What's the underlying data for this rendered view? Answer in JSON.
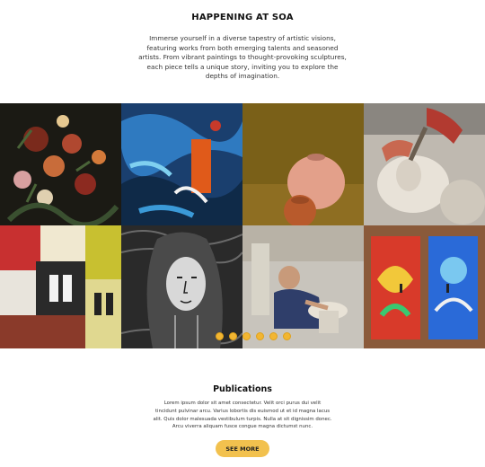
{
  "hero": {
    "title": "HAPPENING AT SOA",
    "description": "Immerse yourself in a diverse tapestry of artistic visions, featuring works from both emerging talents and seasoned artists. From vibrant paintings to thought-provoking sculptures, each piece tells a unique story, inviting you to explore the depths of imagination."
  },
  "gallery": {
    "tiles": [
      {
        "name": "floral-still-life-image"
      },
      {
        "name": "abstract-blue-painting-image"
      },
      {
        "name": "ceramic-vases-image"
      },
      {
        "name": "sculptor-carving-bust-image"
      },
      {
        "name": "street-poster-collage-image"
      },
      {
        "name": "ink-portrait-drawing-image"
      },
      {
        "name": "potter-working-clay-image"
      },
      {
        "name": "painted-doors-image"
      }
    ],
    "carousel_dots": 6,
    "accent_color": "#f2b632"
  },
  "publications": {
    "title": "Publications",
    "description": "Lorem ipsum dolor sit amet consectetur. Velit orci purus dui velit tincidunt pulvinar arcu. Varius lobortis dis euismod ut et id magna lacus alit. Quis dolor malesuada vestibulum turpis. Nulla at sit dignissim donec. Arcu viverra aliquam fusce congue magna dictumst nunc.",
    "button_label": "SEE MORE",
    "button_color": "#f2c14e"
  }
}
